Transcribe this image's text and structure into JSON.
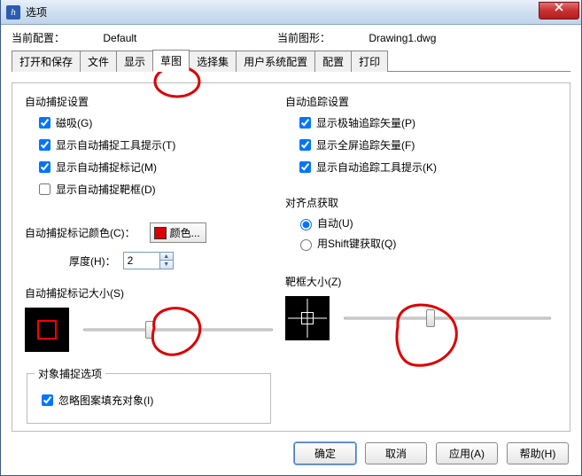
{
  "window": {
    "title": "选项"
  },
  "header": {
    "current_profile_label": "当前配置：",
    "current_profile_value": "Default",
    "current_drawing_label": "当前图形：",
    "current_drawing_value": "Drawing1.dwg"
  },
  "tabs": [
    "打开和保存",
    "文件",
    "显示",
    "草图",
    "选择集",
    "用户系统配置",
    "配置",
    "打印"
  ],
  "active_tab_index": 3,
  "left": {
    "autosnap_group": "自动捕捉设置",
    "magnet": "磁吸(G)",
    "tooltip": "显示自动捕捉工具提示(T)",
    "marker": "显示自动捕捉标记(M)",
    "aperture": "显示自动捕捉靶框(D)",
    "marker_color_label": "自动捕捉标记颜色(C)：",
    "color_btn": "颜色...",
    "thickness_label": "厚度(H)：",
    "thickness_value": "2",
    "marker_size_label": "自动捕捉标记大小(S)",
    "osnap_group": "对象捕捉选项",
    "ignore_hatch": "忽略图案填充对象(I)"
  },
  "right": {
    "autotrack_group": "自动追踪设置",
    "polar_vector": "显示极轴追踪矢量(P)",
    "fullscreen_vector": "显示全屏追踪矢量(F)",
    "track_tooltip": "显示自动追踪工具提示(K)",
    "align_group": "对齐点获取",
    "auto": "自动(U)",
    "shift": "用Shift键获取(Q)",
    "aperture_size_label": "靶框大小(Z)"
  },
  "checks": {
    "magnet": true,
    "tooltip": true,
    "marker": true,
    "aperture": false,
    "polar_vector": true,
    "fullscreen_vector": true,
    "track_tooltip": true,
    "ignore_hatch": true
  },
  "radio": {
    "align": "auto"
  },
  "sliders": {
    "marker_size_pct": 35,
    "aperture_size_pct": 42
  },
  "footer": {
    "ok": "确定",
    "cancel": "取消",
    "apply": "应用(A)",
    "help": "帮助(H)"
  }
}
